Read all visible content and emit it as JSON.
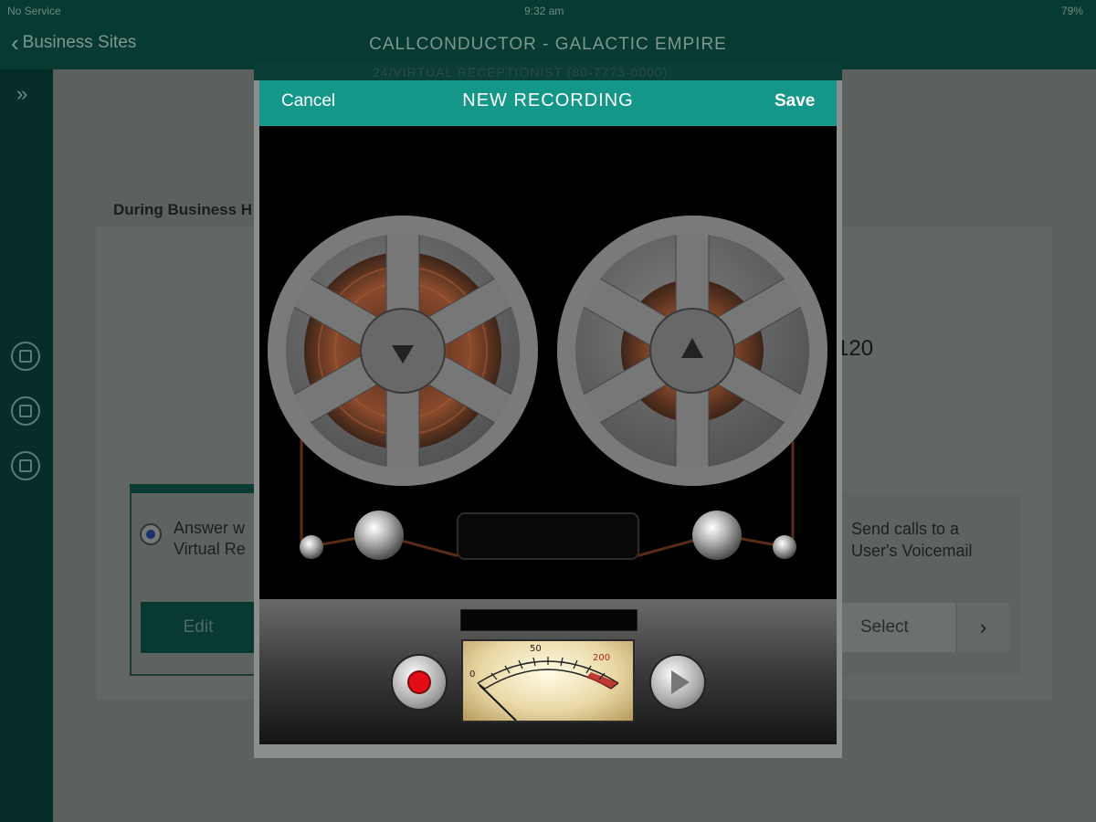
{
  "status": {
    "carrier": "No Service",
    "time": "9:32 am",
    "battery": "79%"
  },
  "nav": {
    "back_label": "Business Sites",
    "title": "CALLCONDUCTOR  -  GALACTIC EMPIRE"
  },
  "background": {
    "business_hours_label": "During Business H",
    "answer_option": "Answer w\nVirtual Re",
    "edit_label": "Edit",
    "number_fragment": "120",
    "send_calls_option": "Send calls to a\nUser's Voicemail",
    "select_label": "Select",
    "select_chevron": "›",
    "modal_underlay_text": "24/VIRTUAL RECEPTIONIST (80-7773-0000)"
  },
  "modal": {
    "cancel_label": "Cancel",
    "title": "NEW RECORDING",
    "save_label": "Save"
  },
  "meter": {
    "tick_0": "0",
    "tick_50": "50",
    "tick_200": "200"
  },
  "colors": {
    "header": "#149789",
    "nav_bg": "#073a31",
    "record_red": "#e30d17"
  }
}
